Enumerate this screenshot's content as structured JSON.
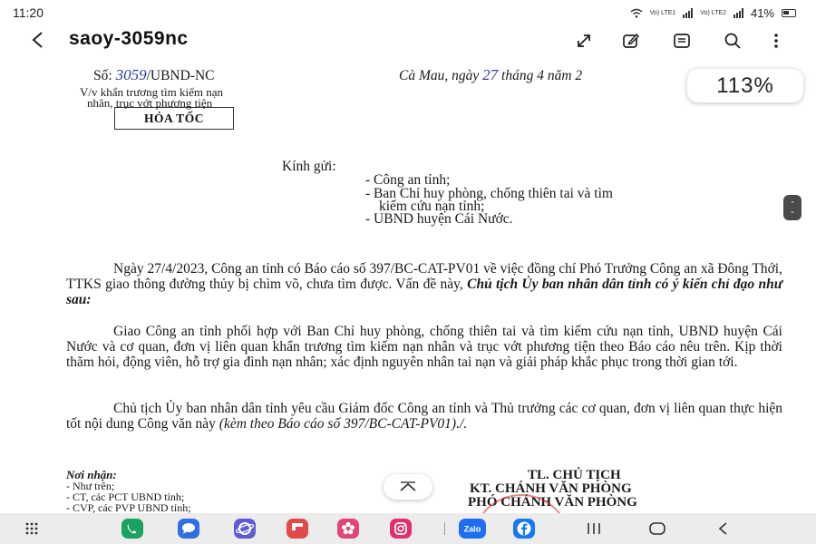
{
  "status": {
    "time": "11:20",
    "lte1": "Vo) LTE1",
    "lte2": "Vo) LTE2",
    "battery": "41%"
  },
  "app": {
    "title": "saoy-3059nc"
  },
  "document": {
    "number_prefix": "Số:",
    "number_handwritten": "3059",
    "number_suffix": "/UBND-NC",
    "place_date_prefix": "Cà Mau, ngày",
    "date_day_handwritten": "27",
    "date_rest": "tháng  4  năm 2",
    "subject_line1": "V/v khẩn trương tìm kiếm nạn",
    "subject_line2": "nhân, trục vớt phương tiện",
    "urgent_stamp": "HỎA TỐC",
    "addressee_intro": "Kính gửi:",
    "addressees": [
      "- Công an tỉnh;",
      "- Ban Chỉ huy phòng, chống thiên tai và tìm",
      "kiếm cứu nạn tỉnh;",
      "- UBND huyện Cái Nước."
    ],
    "para1_text": "Ngày 27/4/2023, Công an tỉnh có Báo cáo số 397/BC-CAT-PV01 về việc đồng chí Phó Trưởng Công an xã Đông Thới, TTKS giao thông đường thủy bị chìm võ, chưa tìm được. Vấn đề này,",
    "para1_emph": "Chủ tịch Ủy ban nhân dân tỉnh có ý kiến chỉ đạo như sau:",
    "para2_text": "Giao Công an tỉnh phối hợp với Ban Chỉ huy phòng, chống thiên tai và tìm kiếm cứu nạn tỉnh, UBND huyện Cái Nước và cơ quan, đơn vị liên quan khẩn trương tìm kiếm nạn nhân và trục vớt phương tiện theo Báo cáo nêu trên. Kịp thời thăm hỏi, động viên, hỗ trợ gia đình nạn nhân; xác định nguyên nhân tai nạn và giải pháp khắc phục trong thời gian tới.",
    "para3_text": "Chủ tịch Ủy ban nhân dân tỉnh yêu cầu Giám đốc Công an tỉnh và Thủ trưởng các cơ quan, đơn vị liên quan thực hiện tốt nội dung Công văn này",
    "para3_italic": "(kèm theo Báo cáo số 397/BC-CAT-PV01)./.",
    "recipients_title": "Nơi nhận:",
    "recipients": [
      "- Như trên;",
      "- CT, các PCT UBND tỉnh;",
      "- CVP, các PVP UBND tỉnh;"
    ],
    "signer_lines": [
      "TL. CHỦ TỊCH",
      "KT. CHÁNH VĂN PHÒNG",
      "PHÓ CHÁNH VĂN PHÒNG"
    ]
  },
  "viewer": {
    "zoom": "113%"
  },
  "dock": {
    "apps": [
      {
        "icon": "phone-icon",
        "color": "#1aa260"
      },
      {
        "icon": "messages-icon",
        "color": "#2f6fe0"
      },
      {
        "icon": "samsung-internet-icon",
        "color": "#5f5bd6"
      },
      {
        "icon": "flipboard-icon",
        "color": "#e24a4a"
      },
      {
        "icon": "blossom-icon",
        "color": "#e0447a"
      },
      {
        "icon": "instagram-icon",
        "color": "#e1306c"
      },
      {
        "icon": "zalo-icon",
        "color": "#1e6ff0",
        "label": "Zalo"
      },
      {
        "icon": "facebook-icon",
        "color": "#1877f2"
      }
    ]
  }
}
